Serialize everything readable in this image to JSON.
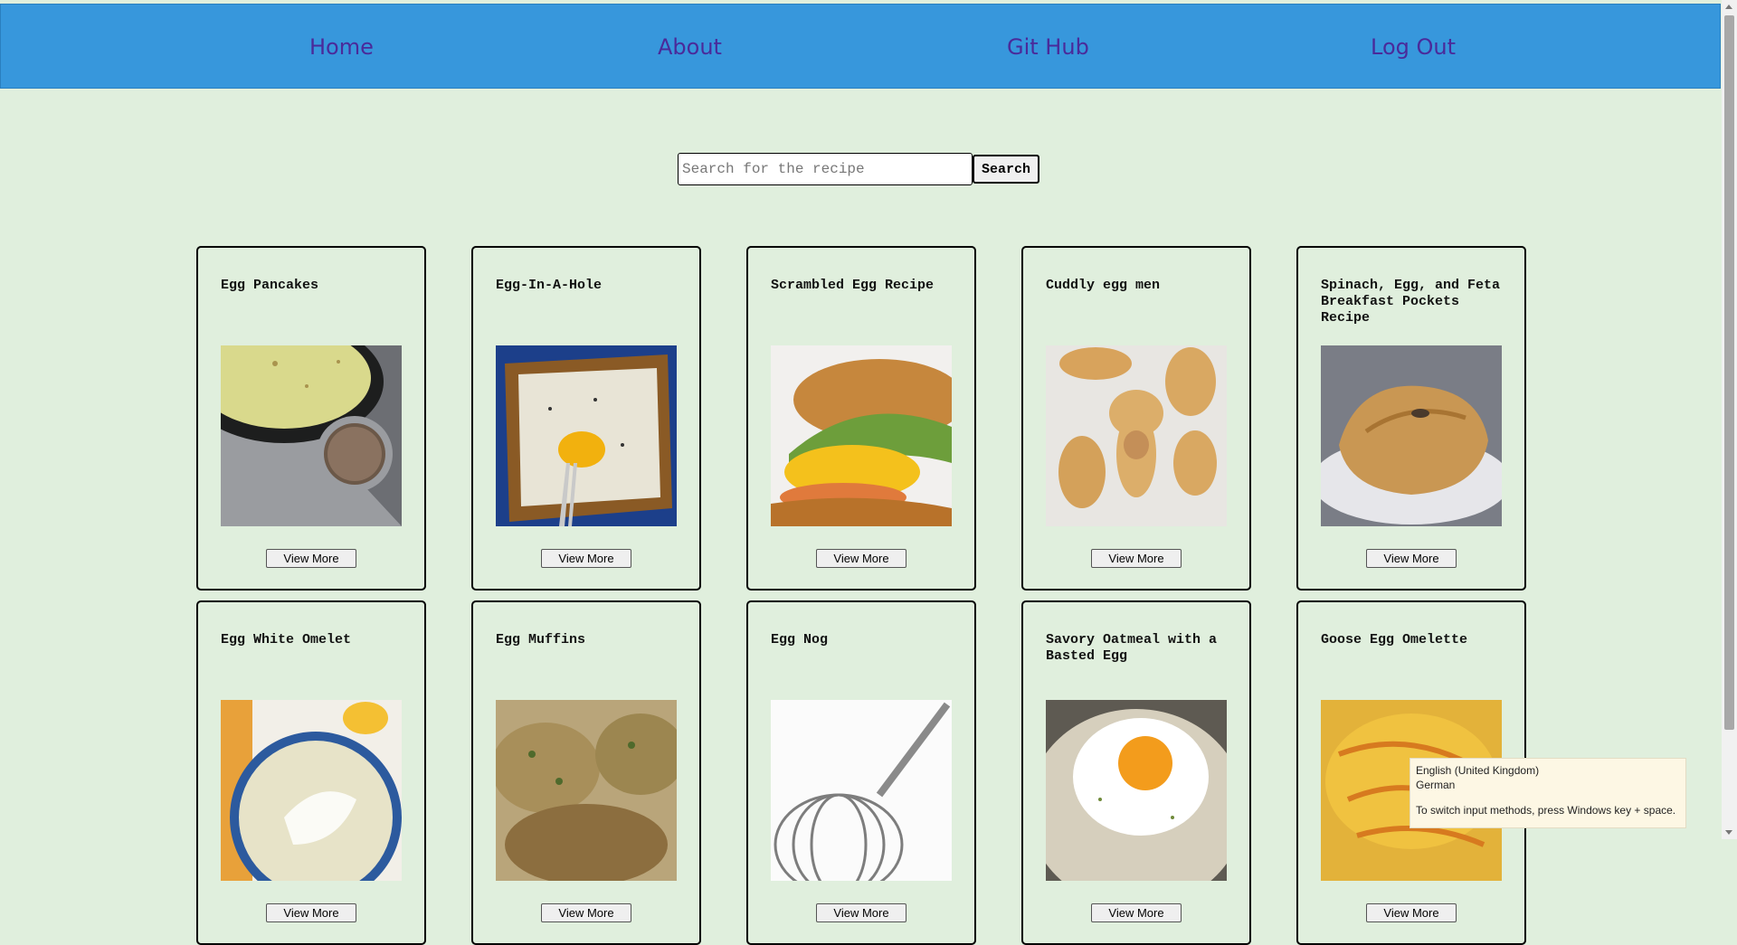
{
  "nav": {
    "items": [
      "Home",
      "About",
      "Git Hub",
      "Log Out"
    ]
  },
  "search": {
    "placeholder": "Search for the recipe",
    "value": "",
    "button_label": "Search"
  },
  "recipes": [
    {
      "title": "Egg Pancakes",
      "button": "View More",
      "image": "egg-pancakes-photo"
    },
    {
      "title": "Egg-In-A-Hole",
      "button": "View More",
      "image": "egg-in-a-hole-photo"
    },
    {
      "title": "Scrambled Egg Recipe",
      "button": "View More",
      "image": "scrambled-egg-photo"
    },
    {
      "title": "Cuddly egg men",
      "button": "View More",
      "image": "cuddly-egg-men-photo"
    },
    {
      "title": "Spinach, Egg, and Feta Breakfast Pockets Recipe",
      "button": "View More",
      "image": "breakfast-pockets-photo"
    },
    {
      "title": "Egg White Omelet",
      "button": "View More",
      "image": "egg-white-omelet-photo"
    },
    {
      "title": "Egg Muffins",
      "button": "View More",
      "image": "egg-muffins-photo"
    },
    {
      "title": "Egg Nog",
      "button": "View More",
      "image": "egg-nog-photo"
    },
    {
      "title": "Savory Oatmeal with a Basted Egg",
      "button": "View More",
      "image": "savory-oatmeal-photo"
    },
    {
      "title": "Goose Egg Omelette",
      "button": "View More",
      "image": "goose-egg-omelette-photo"
    }
  ],
  "ime_tooltip": {
    "line1": "English (United Kingdom)",
    "line2": "German",
    "line3": "To switch input methods, press Windows key + space."
  },
  "colors": {
    "nav_bg": "#3797dc",
    "nav_link": "#4a2a9a",
    "page_bg": "#e0efdd"
  }
}
